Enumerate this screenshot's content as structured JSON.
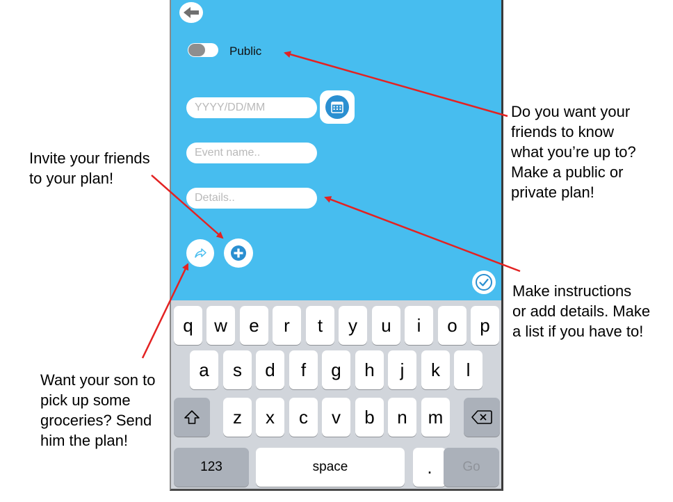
{
  "app": {
    "public_toggle_label": "Public",
    "public_toggle_on": false,
    "date_placeholder": "YYYY/DD/MM",
    "event_name_placeholder": "Event name..",
    "details_placeholder": "Details..",
    "icons": {
      "back": "arrow-left-icon",
      "calendar": "calendar-icon",
      "share": "share-arrow-icon",
      "add": "plus-circle-icon",
      "confirm": "checkmark-circle-icon"
    },
    "colors": {
      "background": "#47bdef",
      "calendar_accent": "#2a8fd1",
      "annotation_arrow": "#e32222"
    }
  },
  "keyboard": {
    "row1": [
      "q",
      "w",
      "e",
      "r",
      "t",
      "y",
      "u",
      "i",
      "o",
      "p"
    ],
    "row2": [
      "a",
      "s",
      "d",
      "f",
      "g",
      "h",
      "j",
      "k",
      "l"
    ],
    "row3": [
      "z",
      "x",
      "c",
      "v",
      "b",
      "n",
      "m"
    ],
    "numbers_label": "123",
    "space_label": "space",
    "period_label": ".",
    "go_label": "Go"
  },
  "annotations": {
    "invite": [
      "Invite your friends",
      "to your plan!"
    ],
    "send": [
      "Want your son to",
      "pick up some",
      "groceries? Send",
      "him the plan!"
    ],
    "public": [
      "Do you want your",
      "friends to know",
      "what you’re up to?",
      "Make a public or",
      "private plan!"
    ],
    "details": [
      "Make instructions",
      "or add details. Make",
      "a list if you have to!"
    ]
  }
}
